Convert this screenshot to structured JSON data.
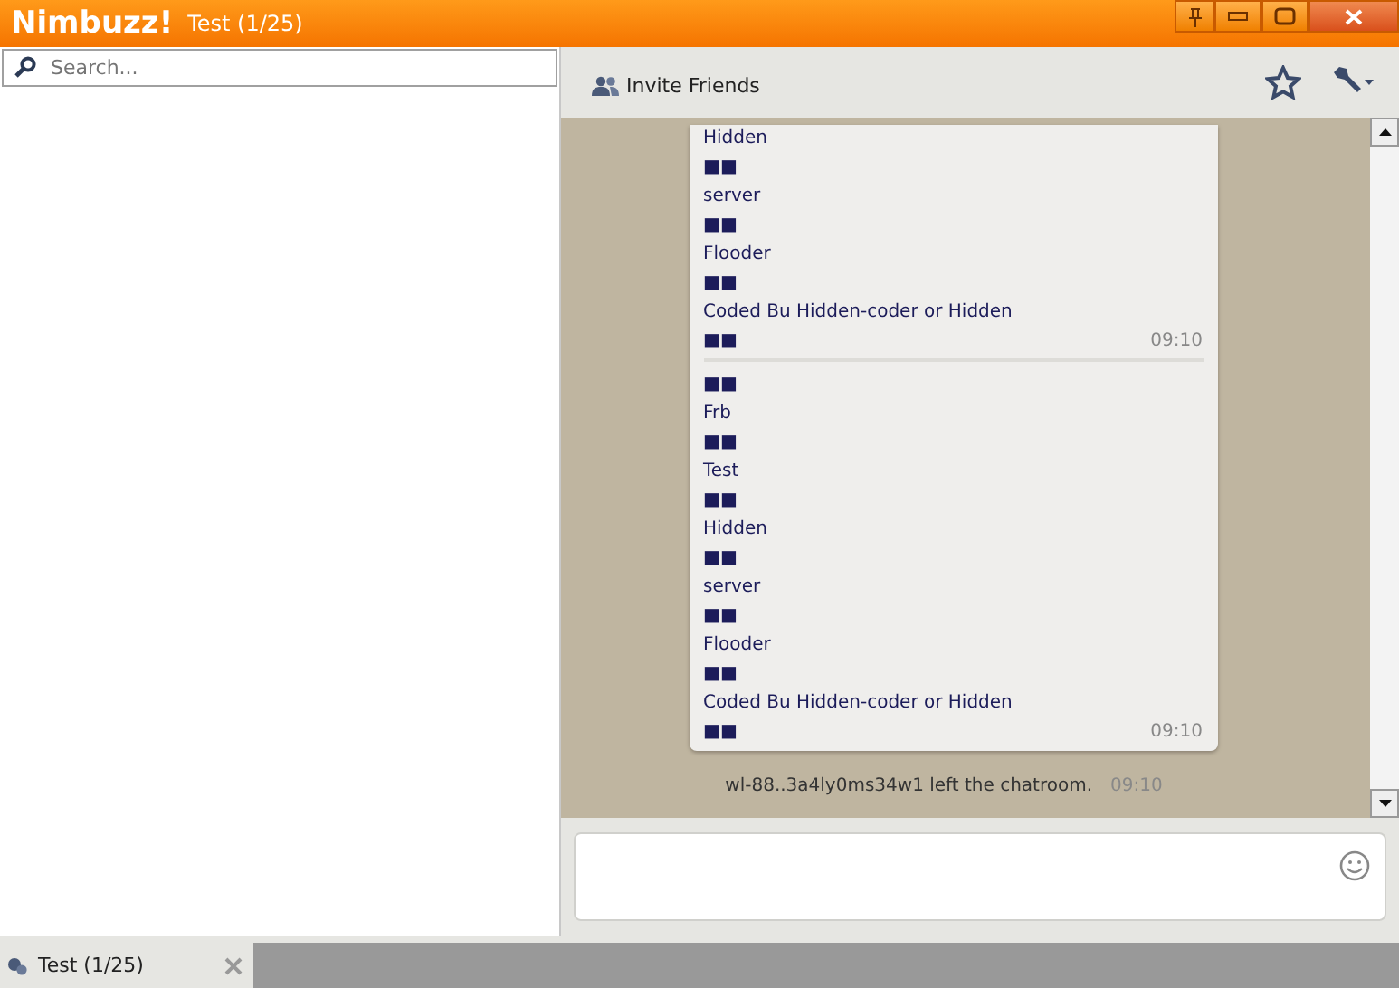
{
  "window": {
    "app_name": "Nimbuzz!",
    "title": "Test (1/25)"
  },
  "sidebar": {
    "search": {
      "placeholder": "Search..."
    }
  },
  "toolbar": {
    "invite_label": "Invite Friends"
  },
  "messages": [
    {
      "lines": [
        "Hidden",
        "■■",
        "server",
        "■■",
        "Flooder",
        "■■",
        "Coded Bu Hidden-coder or Hidden",
        "■■"
      ],
      "time": "09:10"
    },
    {
      "lines": [
        "■■",
        "Frb",
        "■■",
        "Test",
        "■■",
        "Hidden",
        "■■",
        "server",
        "■■",
        "Flooder",
        "■■",
        "Coded Bu Hidden-coder or Hidden",
        "■■"
      ],
      "time": "09:10"
    }
  ],
  "notice": {
    "text": "wl-88..3a4ly0ms34w1 left the chatroom.",
    "time": "09:10"
  },
  "taskbar": {
    "tabs": [
      {
        "label": "Test (1/25)",
        "selected": true
      }
    ]
  }
}
